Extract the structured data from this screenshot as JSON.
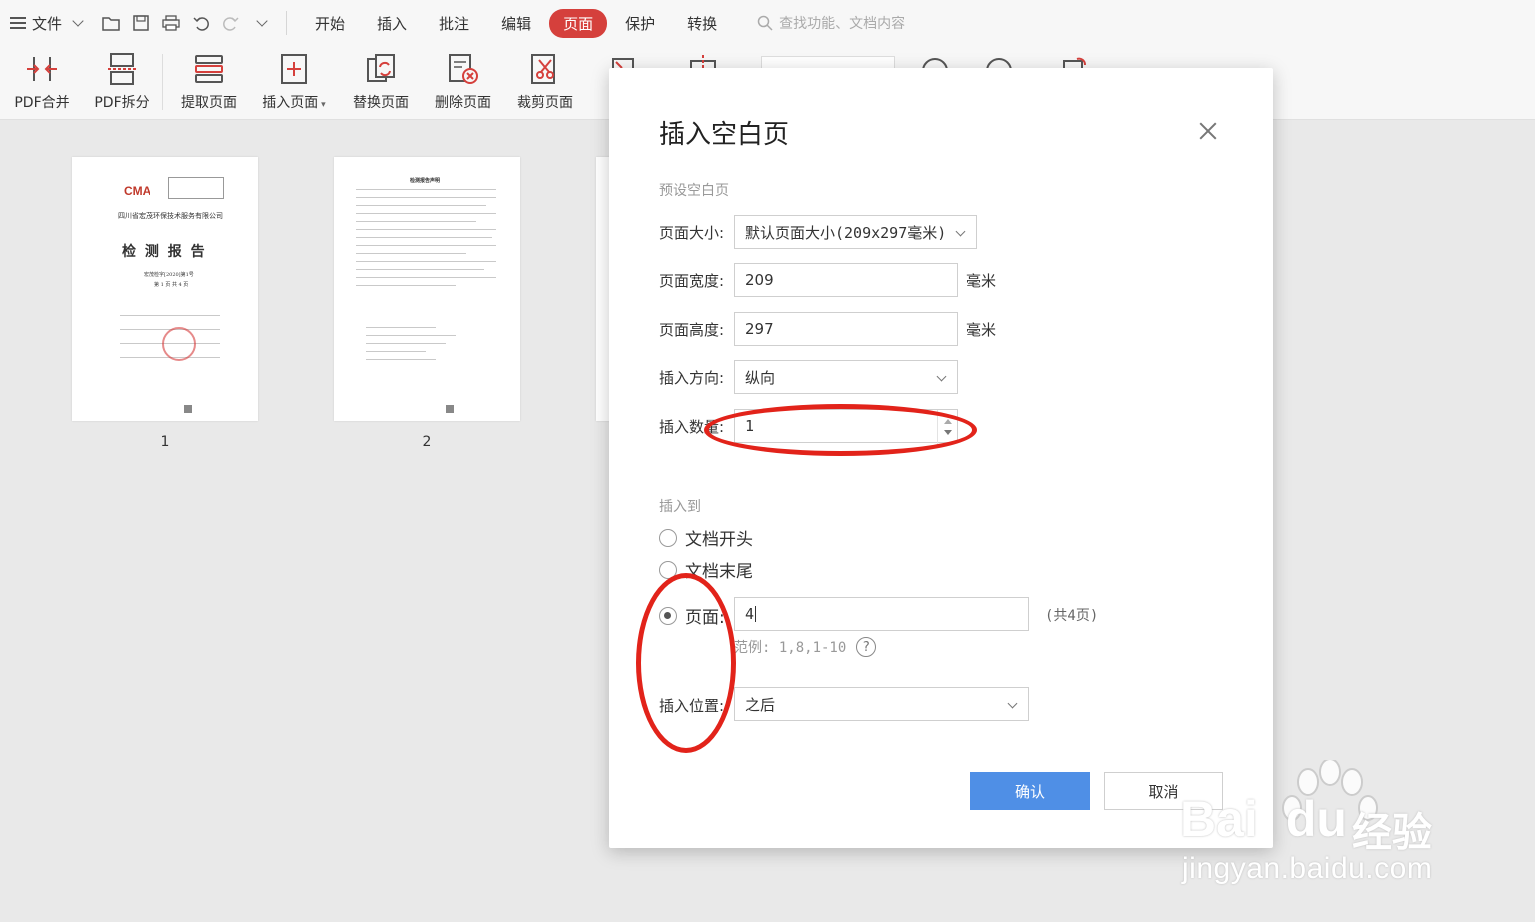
{
  "menubar": {
    "file_label": "文件",
    "tabs": [
      {
        "label": "开始"
      },
      {
        "label": "插入"
      },
      {
        "label": "批注"
      },
      {
        "label": "编辑"
      },
      {
        "label": "页面",
        "active": true
      },
      {
        "label": "保护"
      },
      {
        "label": "转换"
      }
    ],
    "search_placeholder": "查找功能、文档内容",
    "active_tab_color": "#d5403c"
  },
  "ribbon": {
    "buttons": [
      {
        "label": "PDF合并",
        "icon": "merge-icon"
      },
      {
        "label": "PDF拆分",
        "icon": "split-icon"
      },
      {
        "label": "提取页面",
        "icon": "extract-page-icon"
      },
      {
        "label": "插入页面",
        "icon": "insert-page-icon"
      },
      {
        "label": "替换页面",
        "icon": "replace-page-icon"
      },
      {
        "label": "删除页面",
        "icon": "delete-page-icon"
      },
      {
        "label": "裁剪页面",
        "icon": "crop-page-icon"
      }
    ]
  },
  "thumbnails": [
    {
      "page": "1",
      "org": "四川省宏茂环保技术服务有限公司",
      "title": "检 测 报 告",
      "sub1": "宏茂检字[2020]第1号",
      "sub2": "第 1 页 共 4 页"
    },
    {
      "page": "2",
      "heading": "检测报告声明"
    }
  ],
  "dialog": {
    "title": "插入空白页",
    "preset_section": "预设空白页",
    "page_size_label": "页面大小:",
    "page_size_value": "默认页面大小(209x297毫米)",
    "width_label": "页面宽度:",
    "width_value": "209",
    "width_unit": "毫米",
    "height_label": "页面高度:",
    "height_value": "297",
    "height_unit": "毫米",
    "orientation_label": "插入方向:",
    "orientation_value": "纵向",
    "count_label": "插入数量:",
    "count_value": "1",
    "insert_to_section": "插入到",
    "radio_start": "文档开头",
    "radio_end": "文档末尾",
    "radio_page": "页面:",
    "page_value": "4",
    "total_pages": "(共4页)",
    "range_hint": "范例: 1,8,1-10",
    "position_label": "插入位置:",
    "position_value": "之后",
    "ok_label": "确认",
    "cancel_label": "取消",
    "ok_color": "#4f8fe6"
  },
  "watermark": {
    "brand": "Bai",
    "brand2": "du",
    "cn": "经验",
    "url": "jingyan.baidu.com"
  }
}
